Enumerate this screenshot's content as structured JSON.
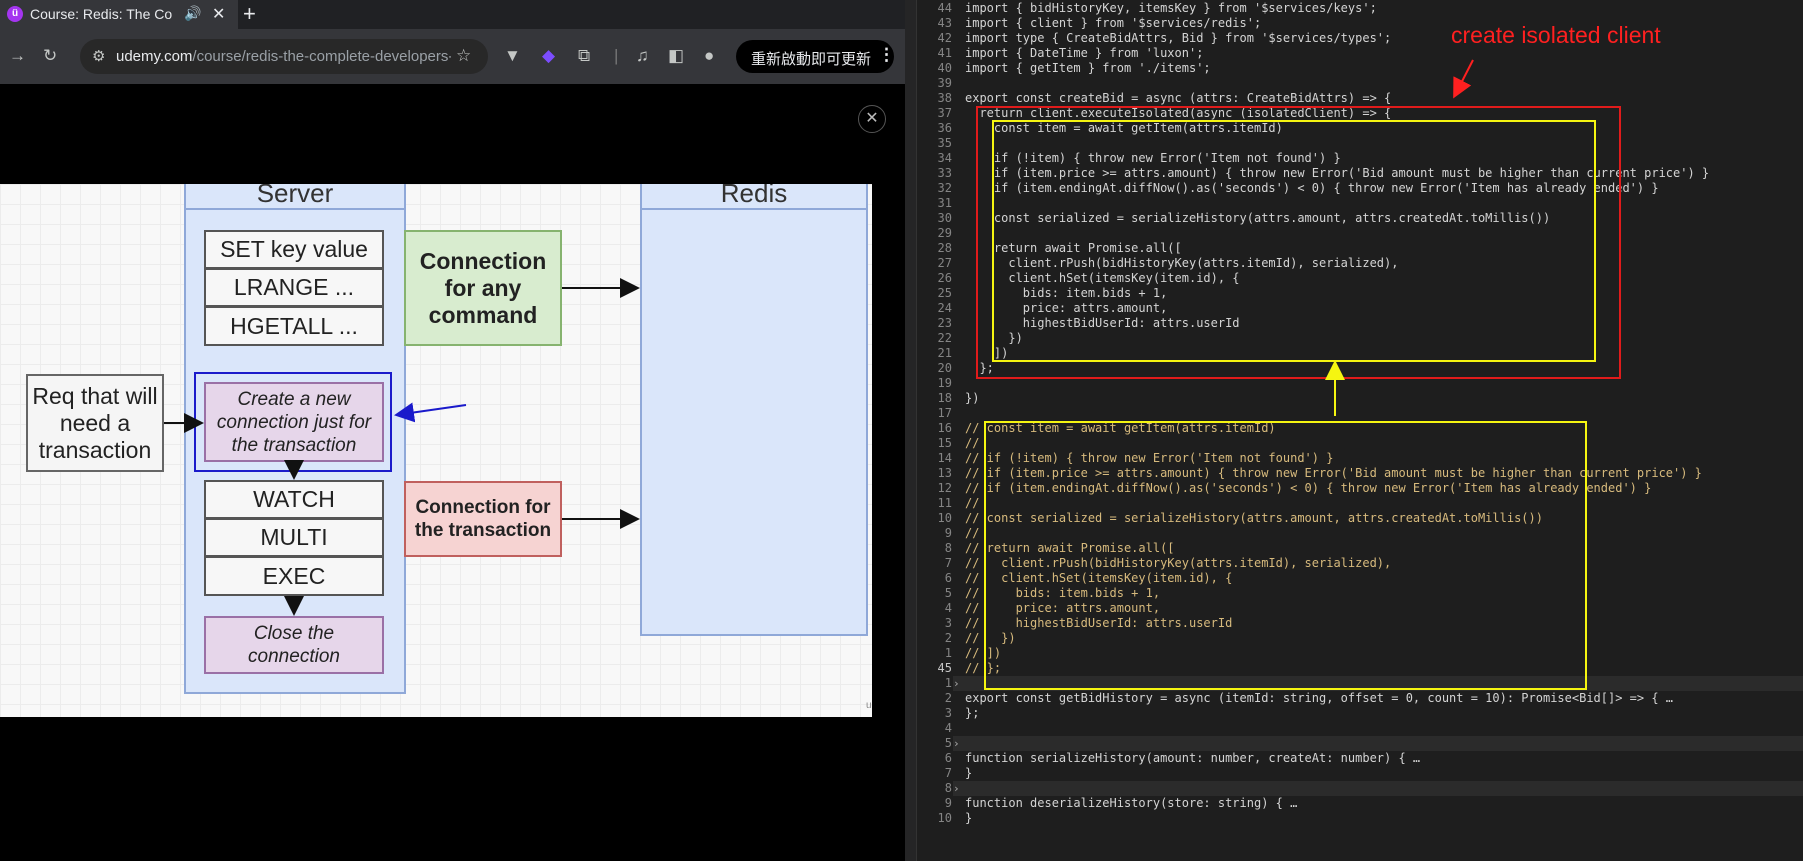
{
  "browser": {
    "tab_title": "Course: Redis: The Co",
    "url_host": "udemy.com",
    "url_path": "/course/redis-the-complete-developers-...",
    "update_button": "重新啟動即可更新"
  },
  "diagram": {
    "server_header": "Server",
    "redis_header": "Redis",
    "commands_top": [
      "SET key value",
      "LRANGE ...",
      "HGETALL ..."
    ],
    "new_connection": "Create a new connection just for the transaction",
    "req_box": "Req that will need a transaction",
    "commands_tx": [
      "WATCH",
      "MULTI",
      "EXEC"
    ],
    "close_connection": "Close the connection",
    "conn_any": "Connection for any command",
    "conn_tx": "Connection for the transaction",
    "watermark": "udemy"
  },
  "editor": {
    "annotation": "create isolated client",
    "line_numbers": [
      "44",
      "43",
      "42",
      "41",
      "40",
      "39",
      "38",
      "37",
      "36",
      "35",
      "34",
      "33",
      "32",
      "31",
      "30",
      "29",
      "28",
      "27",
      "26",
      "25",
      "24",
      "23",
      "22",
      "21",
      "20",
      "19",
      "18",
      "17",
      "16",
      "15",
      "14",
      "13",
      "12",
      "11",
      "10",
      "9",
      "8",
      "7",
      "6",
      "5",
      "4",
      "3",
      "2",
      "1",
      "45",
      "1",
      "2",
      "3",
      "4",
      "5",
      "6",
      "7",
      "8",
      "9",
      "10"
    ],
    "lines": [
      "import { bidHistoryKey, itemsKey } from '$services/keys';",
      "import { client } from '$services/redis';",
      "import type { CreateBidAttrs, Bid } from '$services/types';",
      "import { DateTime } from 'luxon';",
      "import { getItem } from './items';",
      "",
      "export const createBid = async (attrs: CreateBidAttrs) => {",
      "  return client.executeIsolated(async (isolatedClient) => {",
      "    const item = await getItem(attrs.itemId)",
      "",
      "    if (!item) { throw new Error('Item not found') }",
      "    if (item.price >= attrs.amount) { throw new Error('Bid amount must be higher than current price') }",
      "    if (item.endingAt.diffNow().as('seconds') < 0) { throw new Error('Item has already ended') }",
      "",
      "    const serialized = serializeHistory(attrs.amount, attrs.createdAt.toMillis())",
      "",
      "    return await Promise.all([",
      "      client.rPush(bidHistoryKey(attrs.itemId), serialized),",
      "      client.hSet(itemsKey(item.id), {",
      "        bids: item.bids + 1,",
      "        price: attrs.amount,",
      "        highestBidUserId: attrs.userId",
      "      })",
      "    ])",
      "  };",
      "",
      "})",
      "",
      "// const item = await getItem(attrs.itemId)",
      "//",
      "// if (!item) { throw new Error('Item not found') }",
      "// if (item.price >= attrs.amount) { throw new Error('Bid amount must be higher than current price') }",
      "// if (item.endingAt.diffNow().as('seconds') < 0) { throw new Error('Item has already ended') }",
      "//",
      "// const serialized = serializeHistory(attrs.amount, attrs.createdAt.toMillis())",
      "//",
      "// return await Promise.all([",
      "//   client.rPush(bidHistoryKey(attrs.itemId), serialized),",
      "//   client.hSet(itemsKey(item.id), {",
      "//     bids: item.bids + 1,",
      "//     price: attrs.amount,",
      "//     highestBidUserId: attrs.userId",
      "//   })",
      "// ])",
      "// };",
      "",
      "export const getBidHistory = async (itemId: string, offset = 0, count = 10): Promise<Bid[]> => { …",
      "};",
      "",
      "",
      "function serializeHistory(amount: number, createAt: number) { …",
      "}",
      "",
      "function deserializeHistory(store: string) { …",
      "}"
    ]
  }
}
